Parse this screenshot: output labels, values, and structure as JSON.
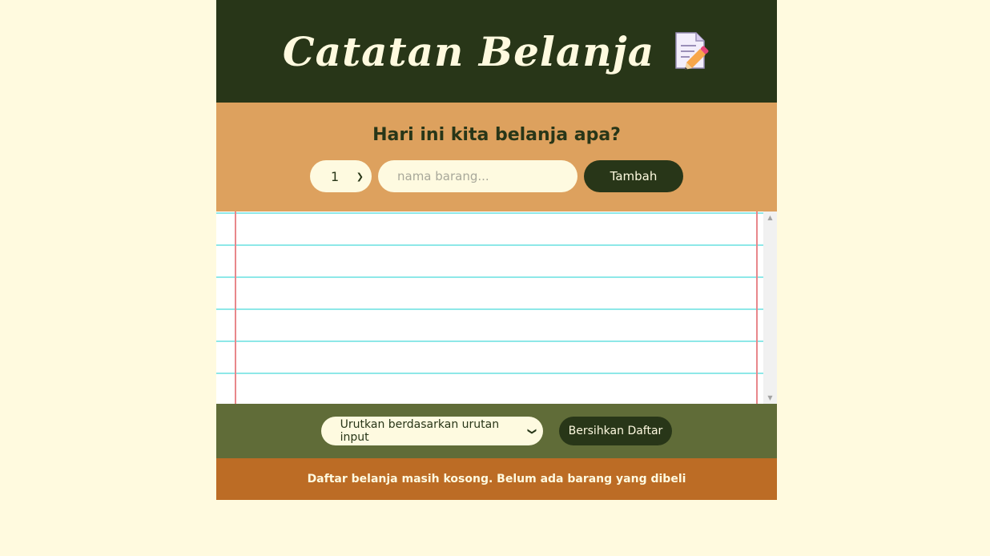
{
  "header": {
    "title": "Catatan Belanja",
    "icon": "memo-icon"
  },
  "form": {
    "heading": "Hari ini kita belanja apa?",
    "quantity_selected": "1",
    "name_placeholder": "nama barang...",
    "add_label": "Tambah"
  },
  "list": {
    "items": []
  },
  "actions": {
    "sort_selected": "Urutkan berdasarkan urutan input",
    "clear_label": "Bersihkan Daftar"
  },
  "footer": {
    "stats": "Daftar belanja masih kosong. Belum ada barang yang dibeli"
  },
  "colors": {
    "page_bg": "#fffadf",
    "header_bg": "#283618",
    "form_bg": "#dda15e",
    "actions_bg": "#606c38",
    "footer_bg": "#bc6c25"
  }
}
